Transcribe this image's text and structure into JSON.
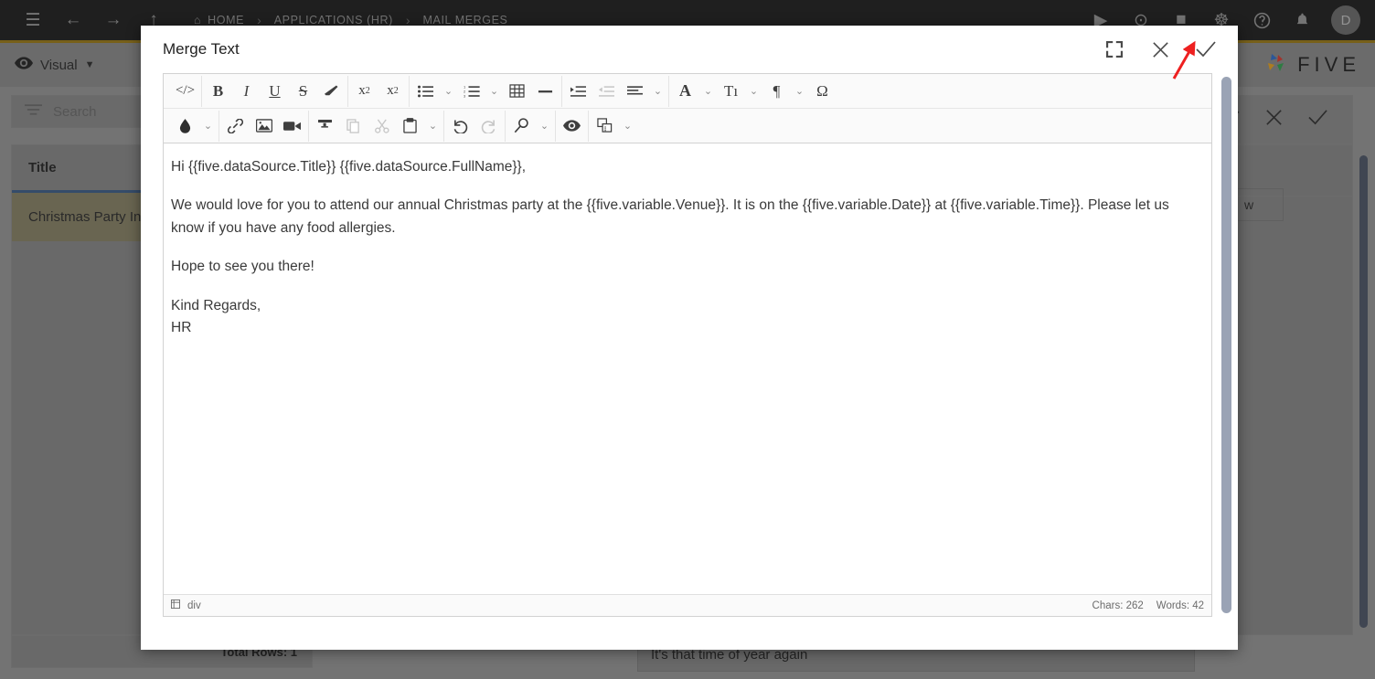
{
  "topbar": {
    "icons": [
      {
        "name": "hamburger-menu-icon",
        "glyph": "☰"
      },
      {
        "name": "back-arrow-icon",
        "glyph": "←"
      },
      {
        "name": "forward-arrow-icon",
        "glyph": "→"
      },
      {
        "name": "up-arrow-icon",
        "glyph": "↑"
      }
    ],
    "breadcrumbs": [
      {
        "label": "HOME",
        "icon": "home-icon"
      },
      {
        "label": "APPLICATIONS (HR)",
        "icon": ""
      },
      {
        "label": "MAIL MERGES",
        "icon": ""
      }
    ],
    "separator": "›",
    "right_icons": [
      {
        "name": "run-icon",
        "glyph": "▶"
      },
      {
        "name": "debug-run-icon",
        "glyph": "⊙"
      },
      {
        "name": "stop-icon",
        "glyph": "■"
      },
      {
        "name": "robot-icon",
        "glyph": "☸"
      },
      {
        "name": "help-icon",
        "glyph": "?"
      },
      {
        "name": "notifications-bell-icon",
        "glyph": "⌂"
      }
    ],
    "avatar_initial": "D"
  },
  "subbar": {
    "visual_label": "Visual",
    "visual_caret": "▼",
    "brand": "FIVE"
  },
  "search": {
    "placeholder": "Search"
  },
  "grid": {
    "column_header": "Title",
    "rows": [
      "Christmas Party Inv"
    ],
    "total_rows_label": "Total Rows: 1"
  },
  "record_toolbar": [
    {
      "name": "delete-record-icon",
      "glyph": "🗑"
    },
    {
      "name": "cancel-record-icon",
      "glyph": "✕"
    },
    {
      "name": "save-record-icon",
      "glyph": "✓"
    }
  ],
  "background_form": {
    "view_button": "w",
    "subject_value": "It's that time of year again"
  },
  "modal": {
    "title": "Merge Text",
    "actions": [
      {
        "name": "expand-fullscreen-button",
        "glyph": "expand"
      },
      {
        "name": "close-modal-button",
        "glyph": "✕"
      },
      {
        "name": "confirm-modal-button",
        "glyph": "✓"
      }
    ]
  },
  "toolbar_row1": [
    {
      "group": 1,
      "items": [
        {
          "name": "source-code-button",
          "label": "</>"
        }
      ]
    },
    {
      "group": 2,
      "items": [
        {
          "name": "bold-button",
          "label": "B",
          "style": "bold-serif"
        },
        {
          "name": "italic-button",
          "label": "I",
          "style": "italic-serif"
        },
        {
          "name": "underline-button",
          "label": "U",
          "style": "underline-serif"
        },
        {
          "name": "strikethrough-button",
          "label": "S",
          "style": "strike-serif"
        },
        {
          "name": "remove-format-button",
          "label": "eraser",
          "style": "icon"
        }
      ]
    },
    {
      "group": 3,
      "items": [
        {
          "name": "superscript-button",
          "label": "x²",
          "style": "sup"
        },
        {
          "name": "subscript-button",
          "label": "x₂",
          "style": "sub"
        }
      ]
    },
    {
      "group": 4,
      "items": [
        {
          "name": "bulleted-list-button",
          "label": "bullets",
          "style": "icon",
          "caret": true
        },
        {
          "name": "numbered-list-button",
          "label": "numbers",
          "style": "icon",
          "caret": true
        },
        {
          "name": "table-button",
          "label": "table",
          "style": "icon"
        },
        {
          "name": "horizontal-rule-button",
          "label": "hrule",
          "style": "icon"
        }
      ]
    },
    {
      "group": 5,
      "items": [
        {
          "name": "increase-indent-button",
          "label": "indent",
          "style": "icon"
        },
        {
          "name": "decrease-indent-button",
          "label": "outdent",
          "style": "icon",
          "dim": true
        },
        {
          "name": "align-button",
          "label": "align",
          "style": "icon",
          "caret": true
        }
      ]
    },
    {
      "group": 6,
      "items": [
        {
          "name": "font-family-button",
          "label": "A",
          "style": "bold-serif",
          "caret": true
        },
        {
          "name": "font-size-button",
          "label": "Tı",
          "style": "serif",
          "caret": true
        },
        {
          "name": "paragraph-format-button",
          "label": "¶",
          "style": "serif",
          "caret": true
        },
        {
          "name": "special-character-button",
          "label": "Ω",
          "style": "serif"
        }
      ]
    }
  ],
  "toolbar_row2": [
    {
      "group": 1,
      "items": [
        {
          "name": "text-color-button",
          "label": "droplet",
          "style": "icon",
          "caret": true
        }
      ]
    },
    {
      "group": 2,
      "items": [
        {
          "name": "insert-link-button",
          "label": "link",
          "style": "icon"
        },
        {
          "name": "insert-image-button",
          "label": "image",
          "style": "icon"
        },
        {
          "name": "insert-video-button",
          "label": "video",
          "style": "icon"
        }
      ]
    },
    {
      "group": 3,
      "items": [
        {
          "name": "format-painter-button",
          "label": "painter",
          "style": "icon"
        },
        {
          "name": "copy-button",
          "label": "copy",
          "style": "icon",
          "dim": true
        },
        {
          "name": "cut-button",
          "label": "scissors",
          "style": "icon",
          "dim": true
        },
        {
          "name": "paste-button",
          "label": "clipboard",
          "style": "icon",
          "caret": true
        }
      ]
    },
    {
      "group": 4,
      "items": [
        {
          "name": "undo-button",
          "label": "undo",
          "style": "icon"
        },
        {
          "name": "redo-button",
          "label": "redo",
          "style": "icon",
          "dim": true
        }
      ]
    },
    {
      "group": 5,
      "items": [
        {
          "name": "search-replace-button",
          "label": "magnifier",
          "style": "icon",
          "caret": true
        }
      ]
    },
    {
      "group": 6,
      "items": [
        {
          "name": "preview-button",
          "label": "eye",
          "style": "icon"
        }
      ]
    },
    {
      "group": 7,
      "items": [
        {
          "name": "merge-field-button",
          "label": "merge",
          "style": "icon",
          "caret": true
        }
      ]
    }
  ],
  "content": {
    "paragraphs": [
      "Hi {{five.dataSource.Title}} {{five.dataSource.FullName}},",
      "We would love for you to attend our annual Christmas party at the {{five.variable.Venue}}. It is on the {{five.variable.Date}} at {{five.variable.Time}}. Please let us know if you have any food allergies.",
      "Hope to see you there!",
      "Kind Regards,"
    ],
    "signature": "HR"
  },
  "statusbar": {
    "element_icon": "element-path-icon",
    "element_path": "div",
    "chars": "Chars: 262",
    "words": "Words: 42"
  },
  "colors": {
    "topbar_bg": "#1b1b1b",
    "gold_rule": "#a07d12",
    "grid_header_underline": "#3c5e8c",
    "selected_row": "#8a8467",
    "scrollbar_thumb": "#9aa3b5",
    "annotation_arrow": "#ee2020"
  }
}
